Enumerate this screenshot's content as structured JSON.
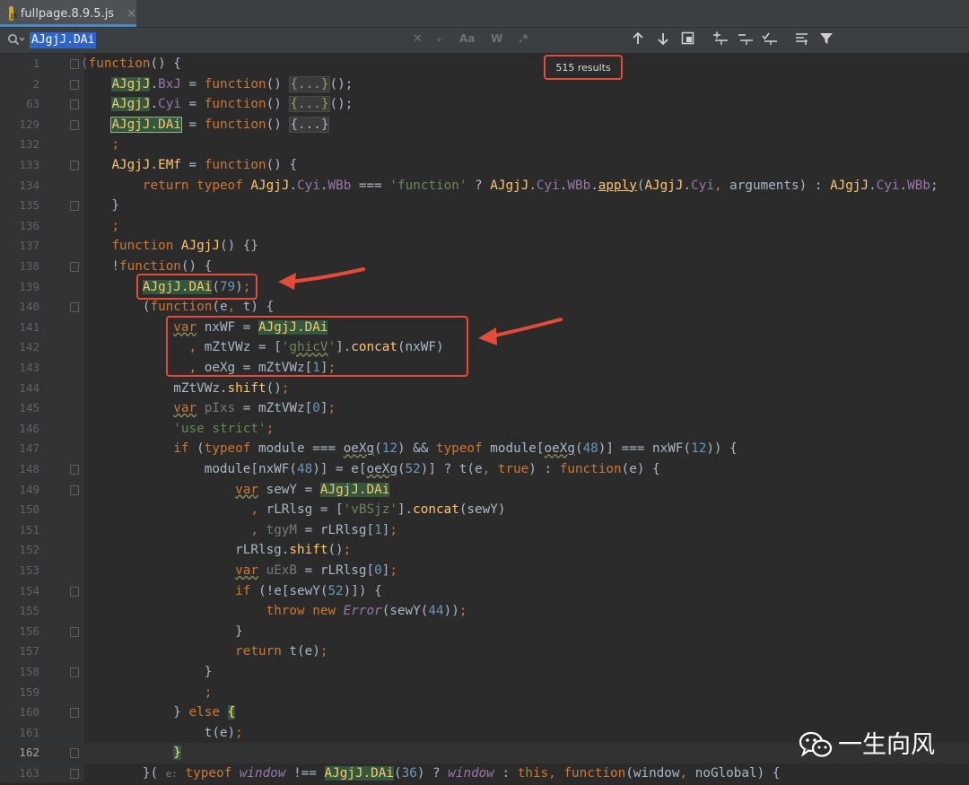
{
  "tab": {
    "filename": "fullpage.8.9.5.js",
    "close": "×",
    "badge": "JS"
  },
  "find": {
    "query": "AJgjJ.DAi",
    "results": "515 results"
  },
  "watermark": {
    "text": "一生向风"
  },
  "lines": [
    {
      "num": "1",
      "html": "<span class=\"dim\">(</span><span class=\"k\">function</span>() {"
    },
    {
      "num": "2",
      "html": "    <span class=\"hl\">AJgjJ</span>.<span class=\"p\">BxJ</span> = <span class=\"k\">function</span>() <span class=\"fcg\">{...}</span>();"
    },
    {
      "num": "63",
      "html": "    <span class=\"hl\">AJgjJ</span>.<span class=\"p\">Cyi</span> = <span class=\"k\">function</span>() <span class=\"fcg\">{...}</span>();"
    },
    {
      "num": "129",
      "html": "    <span class=\"hl\" style=\"outline:1px solid #8bb58c\">AJgjJ.DAi</span> = <span class=\"k\">function</span>() <span class=\"fc\">{...}</span>"
    },
    {
      "num": "132",
      "html": "    <span class=\"k\">;</span>"
    },
    {
      "num": "133",
      "html": "    <span class=\"f\">AJgjJ</span>.<span class=\"f\">EMf</span> = <span class=\"k\">function</span>() {"
    },
    {
      "num": "134",
      "html": "        <span class=\"k\">return typeof</span> <span class=\"f\">AJgjJ</span>.<span class=\"p\">Cyi</span>.<span class=\"p\">WBb</span> === <span class=\"s\">'function'</span> ? <span class=\"f\">AJgjJ</span>.<span class=\"p\">Cyi</span>.<span class=\"p\">WBb</span>.<span class=\"f\" style=\"text-decoration:underline\">apply</span>(<span class=\"f\">AJgjJ</span>.<span class=\"p\">Cyi</span><span class=\"k\">,</span> arguments) : <span class=\"f\">AJgjJ</span>.<span class=\"p\">Cyi</span>.<span class=\"p\">WBb</span>;"
    },
    {
      "num": "135",
      "html": "    }"
    },
    {
      "num": "136",
      "html": "    <span class=\"k\">;</span>"
    },
    {
      "num": "137",
      "html": "    <span class=\"k\">function</span> <span class=\"f\">AJgjJ</span>() {}"
    },
    {
      "num": "138",
      "html": "    !<span class=\"k\">function</span>() {"
    },
    {
      "num": "139",
      "html": "        <span class=\"hl\">AJgjJ.DAi</span>(<span class=\"n\">79</span>)<span class=\"k\">;</span>"
    },
    {
      "num": "140",
      "html": "        (<span class=\"k\">function</span>(e<span class=\"k\">,</span> t) {"
    },
    {
      "num": "141",
      "html": "            <span class=\"k\" style=\"text-decoration:underline wavy #8a8a5a\">var</span> nxWF = <span class=\"hl\">AJgjJ.DAi</span>"
    },
    {
      "num": "142",
      "html": "              <span class=\"k\">,</span> mZtVWz = [<span class=\"s\">'<span style=\"text-decoration:underline wavy #8a8a5a\">ghicV</span>'</span>].<span class=\"f\">concat</span>(nxWF)"
    },
    {
      "num": "143",
      "html": "              <span class=\"k\">,</span> oeXg = mZtVWz[<span class=\"n\">1</span>]<span class=\"k\">;</span>"
    },
    {
      "num": "144",
      "html": "            mZtVWz.<span class=\"f\">shift</span>()<span class=\"k\">;</span>"
    },
    {
      "num": "145",
      "html": "            <span class=\"k\" style=\"text-decoration:underline wavy #8a8a5a\">var</span> <span class=\"dim\">pIxs</span> = mZtVWz[<span class=\"n\">0</span>]<span class=\"k\">;</span>"
    },
    {
      "num": "146",
      "html": "            <span class=\"s\">'use strict'</span><span class=\"k\">;</span>"
    },
    {
      "num": "147",
      "html": "            <span class=\"k\">if</span> (<span class=\"k\">typeof</span> module === <span style=\"text-decoration:underline wavy #8a8a5a\">oeXg</span>(<span class=\"n\">12</span>) && <span class=\"k\">typeof</span> module[<span style=\"text-decoration:underline wavy #8a8a5a\">oeXg</span>(<span class=\"n\">48</span>)] === nxWF(<span class=\"n\">12</span>)) {"
    },
    {
      "num": "148",
      "html": "                module[nxWF(<span class=\"n\">48</span>)] = e[<span style=\"text-decoration:underline wavy #8a8a5a\">oeXg</span>(<span class=\"n\">52</span>)] ? t(e<span class=\"k\">,</span> <span class=\"k\">true</span>) : <span class=\"k\">function</span>(e) {"
    },
    {
      "num": "149",
      "html": "                    <span class=\"k\" style=\"text-decoration:underline wavy #8a8a5a\">var</span> sewY = <span class=\"hl\">AJgjJ.DAi</span>"
    },
    {
      "num": "150",
      "html": "                      <span class=\"k\">,</span> rLRlsg = [<span class=\"s\">'vBSjz'</span>].<span class=\"f\">concat</span>(sewY)"
    },
    {
      "num": "151",
      "html": "                      <span class=\"k\">,</span> <span class=\"dim\">tgyM</span> = rLRlsg[<span class=\"n\">1</span>]<span class=\"k\">;</span>"
    },
    {
      "num": "152",
      "html": "                    rLRlsg.<span class=\"f\">shift</span>()<span class=\"k\">;</span>"
    },
    {
      "num": "153",
      "html": "                    <span class=\"k\" style=\"text-decoration:underline wavy #8a8a5a\">var</span> <span class=\"dim\">uExB</span> = rLRlsg[<span class=\"n\">0</span>]<span class=\"k\">;</span>"
    },
    {
      "num": "154",
      "html": "                    <span class=\"k\">if</span> (!e[sewY(<span class=\"n\">52</span>)]) {"
    },
    {
      "num": "155",
      "html": "                        <span class=\"k\">throw new</span> <span class=\"pi\">Error</span>(sewY(<span class=\"n\">44</span>))<span class=\"k\">;</span>"
    },
    {
      "num": "156",
      "html": "                    }"
    },
    {
      "num": "157",
      "html": "                    <span class=\"k\">return</span> t(e)<span class=\"k\">;</span>"
    },
    {
      "num": "158",
      "html": "                }"
    },
    {
      "num": "159",
      "html": "                <span class=\"k\">;</span>"
    },
    {
      "num": "160",
      "html": "            } <span class=\"k\">else</span> <span class=\"braceh\">{</span>"
    },
    {
      "num": "161",
      "html": "                t(e)<span class=\"k\">;</span>"
    },
    {
      "num": "162",
      "html": "            <span class=\"braceh\">}</span>"
    },
    {
      "num": "163",
      "html": "        }( <span class=\"dim\" style=\"font-size:11px\">e:</span> <span class=\"k\">typeof</span> <span class=\"pi\">window</span> !== <span class=\"hl\">AJgjJ.DAi</span>(<span class=\"n\">36</span>) ? <span class=\"pi\">window</span> : <span class=\"k\">this</span><span class=\"k\">,</span> <span class=\"k\">function</span>(window<span class=\"k\">,</span> noGlobal) {"
    }
  ]
}
